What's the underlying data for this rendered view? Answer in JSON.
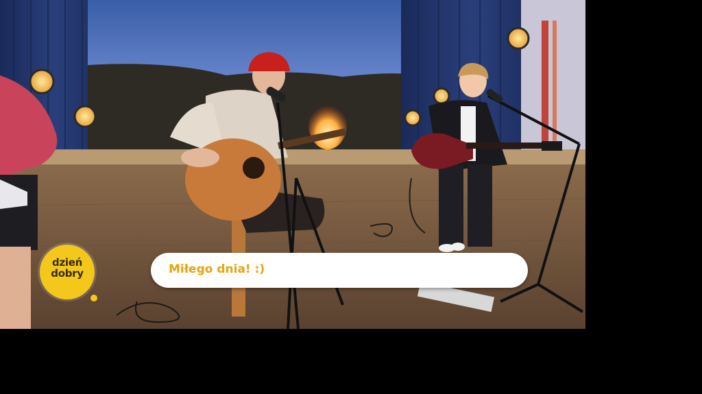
{
  "broadcast": {
    "logo": {
      "line1": "dzień",
      "line2": "dobry"
    },
    "caption": "Miłego dnia! :)"
  },
  "colors": {
    "logo_yellow": "#f3c81a",
    "caption_text": "#e8a40e",
    "caption_bg": "#ffffff",
    "letterbox": "#000000"
  }
}
